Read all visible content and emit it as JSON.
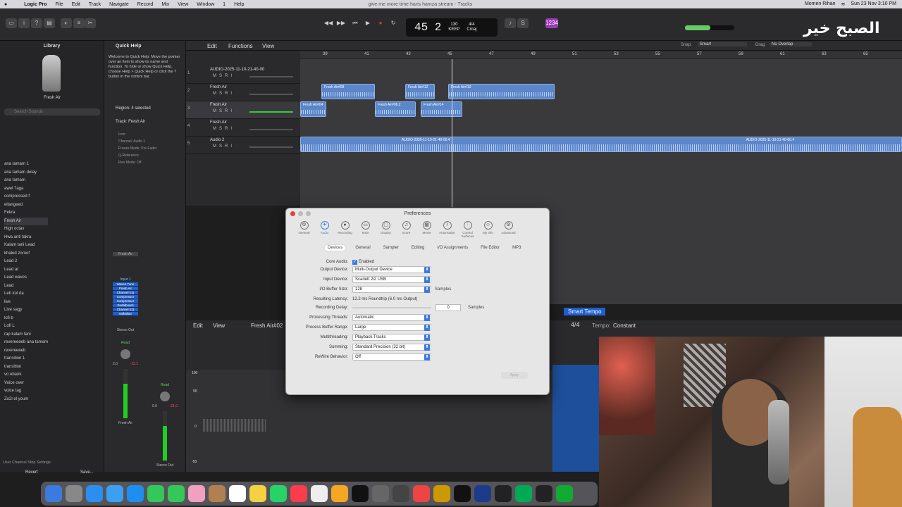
{
  "menubar": {
    "items": [
      "Logic Pro",
      "File",
      "Edit",
      "Track",
      "Navigate",
      "Record",
      "Mix",
      "View",
      "Window",
      "1",
      "Help"
    ],
    "window_title": "give me more time haris hamza stream - Tracks",
    "user": "Momen Rihan",
    "clock": "Sun 23 Nov 3:10 PM"
  },
  "lcd": {
    "position": "45 2",
    "tempo": "130",
    "tempo_label": "KEEP",
    "signature": "4/4",
    "key": "Cmaj"
  },
  "watermark": "الصبح خير",
  "library": {
    "title": "Library",
    "selected_preset": "Fresh Air",
    "search_placeholder": "Search Sounds",
    "items": [
      "ana tamam 1",
      "ana tamam delay",
      "ana tamam",
      "awel 7aga",
      "compressed f",
      "ellangeed",
      "Fekra",
      "Fresh Air",
      "High octav",
      "Hwa anti fakra",
      "Kalam tani Lead",
      "khaled zoroof",
      "Lead 2",
      "Lead at",
      "Lead waves",
      "Lead",
      "Leh kol da",
      "live",
      "Live sagy",
      "lofi b",
      "Lofi L",
      "rap kalam tani",
      "revereeeeb ana tamam",
      "revereeeeb",
      "transition 1",
      "transition",
      "vo ebank",
      "Voice over",
      "voice tag",
      "Zo2l el youm"
    ],
    "footer": "User Channel Strip Settings",
    "revert": "Revert",
    "save": "Save..."
  },
  "quickhelp": {
    "title": "Quick Help",
    "text": "Welcome to Quick Help. Move the pointer over an item to show its name and function. To hide or show Quick Help, choose Help > Quick Help or click the ? button in the control bar.",
    "region": "Region: 4 selected",
    "track": "Track: Fresh Air",
    "params": [
      "Icon:",
      "Channel: Audio 1",
      "Freeze Mode: Pre Fader",
      "Q-Reference:",
      "Flex Mode: Off"
    ]
  },
  "strip": {
    "a_name": "Fresh Air",
    "b_name": "Stereo Out",
    "input": "Input 1",
    "plugins": [
      "Waves Tune",
      "Fresh Air",
      "Channel EQ",
      "Compressor",
      "Compressor",
      "Pedalboard",
      "Channel EQ",
      "ValhallaV"
    ],
    "out": "Stereo Out",
    "read": "Read",
    "a_vals": [
      "2.0",
      "-12.1"
    ],
    "b_vals": [
      "0.0",
      "-21.0"
    ]
  },
  "tracks_header": {
    "edit": "Edit",
    "functions": "Functions",
    "view": "View",
    "snap_label": "Snap:",
    "snap": "Smart",
    "drag_label": "Drag:",
    "drag": "No Overlap"
  },
  "ruler": [
    "39",
    "41",
    "43",
    "45",
    "47",
    "49",
    "51",
    "53",
    "55",
    "57",
    "59",
    "61",
    "63",
    "65"
  ],
  "tracks": [
    {
      "num": "1",
      "name": "AUDIO-2025-11-10-21-40-00"
    },
    {
      "num": "2",
      "name": "Fresh Air"
    },
    {
      "num": "3",
      "name": "Fresh Air"
    },
    {
      "num": "4",
      "name": "Fresh Air"
    },
    {
      "num": "5",
      "name": "Audio 2"
    }
  ],
  "regions": [
    "Fresh Air#08",
    "Fresh Air#12",
    "Fresh Air#10",
    "Fresh Air#04",
    "Fresh Air#06.2",
    "Fresh Air#14",
    "AUDIO-2025-11-10-21-40-00.4",
    "AUDIO-2025-11-10-21-40-00.4"
  ],
  "editor": {
    "edit": "Edit",
    "view": "View",
    "region": "Fresh Air#02",
    "smart_tempo": "Smart Tempo",
    "signature": "4/4",
    "tempo_label": "Tempo:",
    "tempo": "Constant",
    "scale": [
      "100",
      "50",
      "0",
      "-50"
    ]
  },
  "prefs": {
    "title": "Preferences",
    "categories": [
      "General",
      "Audio",
      "Recording",
      "MIDI",
      "Display",
      "Score",
      "Movie",
      "Automation",
      "Control Surfaces",
      "My Info",
      "Advanced"
    ],
    "subtabs": [
      "Devices",
      "General",
      "Sampler",
      "Editing",
      "I/O Assignments",
      "File Editor",
      "MP3"
    ],
    "rows": {
      "core_audio": {
        "label": "Core Audio:",
        "value": "Enabled"
      },
      "output": {
        "label": "Output Device:",
        "value": "Multi-Output Device"
      },
      "input": {
        "label": "Input Device:",
        "value": "Scarlett 2i2 USB"
      },
      "buffer": {
        "label": "I/O Buffer Size:",
        "value": "128",
        "unit": "Samples"
      },
      "latency": {
        "label": "Resulting Latency:",
        "value": "12.2 ms Roundtrip (6.0 ms Output)"
      },
      "delay": {
        "label": "Recording Delay:",
        "value": "0",
        "unit": "Samples"
      },
      "threads": {
        "label": "Processing Threads:",
        "value": "Automatic"
      },
      "range": {
        "label": "Process Buffer Range:",
        "value": "Large"
      },
      "multithreading": {
        "label": "Multithreading:",
        "value": "Playback Tracks"
      },
      "summing": {
        "label": "Summing:",
        "value": "Standard Precision (32 bit)"
      },
      "rewire": {
        "label": "ReWire Behavior:",
        "value": "Off"
      }
    },
    "apply": "Apply"
  }
}
